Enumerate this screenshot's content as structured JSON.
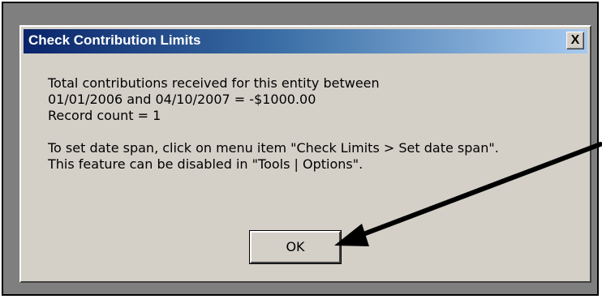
{
  "dialog": {
    "title": "Check Contribution Limits",
    "close_label": "X",
    "message_lines": [
      "Total contributions received for this entity between",
      "01/01/2006 and 04/10/2007 = -$1000.00",
      "Record count = 1",
      "",
      "To set date span, click on menu item \"Check Limits > Set date span\".",
      "This feature can be disabled in \"Tools | Options\"."
    ],
    "ok_label": "OK"
  },
  "colors": {
    "dialog_face": "#d4d0c8",
    "titlebar_start": "#0a246a",
    "titlebar_end": "#a6caf0",
    "frame": "#7f7f7f",
    "annotation_arrow": "#000000"
  }
}
